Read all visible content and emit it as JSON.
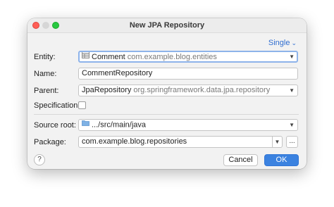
{
  "window": {
    "title": "New JPA Repository"
  },
  "mode_selector": {
    "label": "Single",
    "chevron": "⌄"
  },
  "form": {
    "entity": {
      "label": "Entity:",
      "value": "Comment",
      "qualifier": "com.example.blog.entities",
      "icon": "entity-table-icon"
    },
    "name": {
      "label": "Name:",
      "value": "CommentRepository"
    },
    "parent": {
      "label": "Parent:",
      "value": "JpaRepository",
      "qualifier": "org.springframework.data.jpa.repository"
    },
    "specification": {
      "label": "Specification:",
      "checked": false
    },
    "source_root": {
      "label": "Source root:",
      "value": ".../src/main/java",
      "icon": "folder-icon"
    },
    "package": {
      "label": "Package:",
      "value": "com.example.blog.repositories",
      "browse_label": "..."
    }
  },
  "footer": {
    "help_label": "?",
    "cancel_label": "Cancel",
    "ok_label": "OK"
  },
  "colors": {
    "accent": "#3b82e0",
    "link": "#2f6dd0",
    "close": "#ff5f57",
    "maximize": "#28c840",
    "folder": "#7fb2e5"
  }
}
